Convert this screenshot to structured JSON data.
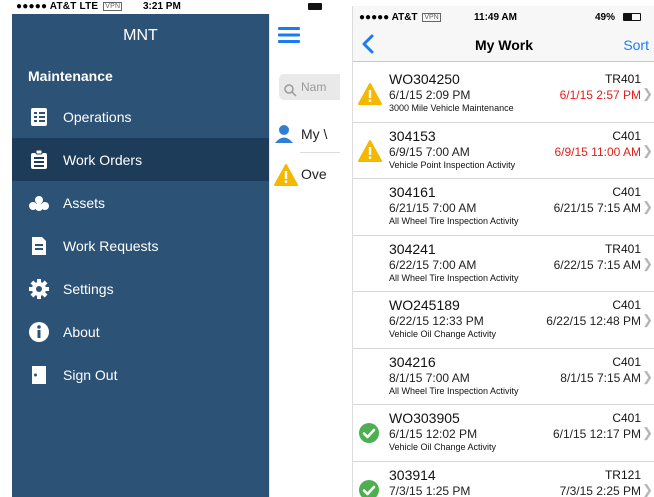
{
  "left_phone": {
    "status_bar": {
      "carrier": "●●●●● AT&T LTE",
      "vpn": "VPN",
      "time": "3:21 PM"
    },
    "drawer": {
      "title": "MNT",
      "section": "Maintenance",
      "items": [
        {
          "label": "Operations",
          "icon": "operations-icon",
          "active": false
        },
        {
          "label": "Work Orders",
          "icon": "work-orders-icon",
          "active": true
        },
        {
          "label": "Assets",
          "icon": "assets-icon",
          "active": false
        },
        {
          "label": "Work Requests",
          "icon": "work-requests-icon",
          "active": false
        },
        {
          "label": "Settings",
          "icon": "gear-icon",
          "active": false
        },
        {
          "label": "About",
          "icon": "info-icon",
          "active": false
        },
        {
          "label": "Sign Out",
          "icon": "sign-out-icon",
          "active": false
        }
      ]
    },
    "content": {
      "search_placeholder": "Nam",
      "rows": [
        {
          "label": "My \\",
          "icon": "user-icon"
        },
        {
          "label": "Ove",
          "icon": "warning-icon"
        }
      ]
    }
  },
  "right_phone": {
    "status_bar": {
      "carrier": "●●●●● AT&T",
      "vpn": "VPN",
      "time": "11:49 AM",
      "battery": "49%"
    },
    "nav": {
      "title": "My Work",
      "sort": "Sort"
    },
    "work_orders": [
      {
        "id": "WO304250",
        "asset": "TR401",
        "start": "6/1/15 2:09 PM",
        "due": "6/1/15 2:57 PM",
        "description": "3000 Mile Vehicle Maintenance",
        "status": "warning",
        "overdue": true
      },
      {
        "id": "304153",
        "asset": "C401",
        "start": "6/9/15 7:00 AM",
        "due": "6/9/15 11:00 AM",
        "description": "Vehicle Point Inspection Activity",
        "status": "warning",
        "overdue": true
      },
      {
        "id": "304161",
        "asset": "C401",
        "start": "6/21/15 7:00 AM",
        "due": "6/21/15 7:15 AM",
        "description": "All Wheel Tire Inspection Activity",
        "status": "none",
        "overdue": false
      },
      {
        "id": "304241",
        "asset": "TR401",
        "start": "6/22/15 7:00 AM",
        "due": "6/22/15 7:15 AM",
        "description": "All Wheel Tire Inspection Activity",
        "status": "none",
        "overdue": false
      },
      {
        "id": "WO245189",
        "asset": "C401",
        "start": "6/22/15 12:33 PM",
        "due": "6/22/15 12:48 PM",
        "description": "Vehicle Oil Change Activity",
        "status": "none",
        "overdue": false
      },
      {
        "id": "304216",
        "asset": "C401",
        "start": "8/1/15 7:00 AM",
        "due": "8/1/15 7:15 AM",
        "description": "All Wheel Tire Inspection Activity",
        "status": "none",
        "overdue": false
      },
      {
        "id": "WO303905",
        "asset": "C401",
        "start": "6/1/15 12:02 PM",
        "due": "6/1/15 12:17 PM",
        "description": "Vehicle Oil Change Activity",
        "status": "complete",
        "overdue": false
      },
      {
        "id": "303914",
        "asset": "TR121",
        "start": "7/3/15 1:25 PM",
        "due": "7/3/15 2:25 PM",
        "description": "",
        "status": "complete",
        "overdue": false
      }
    ]
  },
  "colors": {
    "drawer_bg": "#2c5275",
    "drawer_active": "#1d3c5a",
    "accent_blue": "#1a7cf5",
    "overdue_red": "#e0201b",
    "warning_yellow": "#f5b800",
    "complete_green": "#4caf50"
  }
}
